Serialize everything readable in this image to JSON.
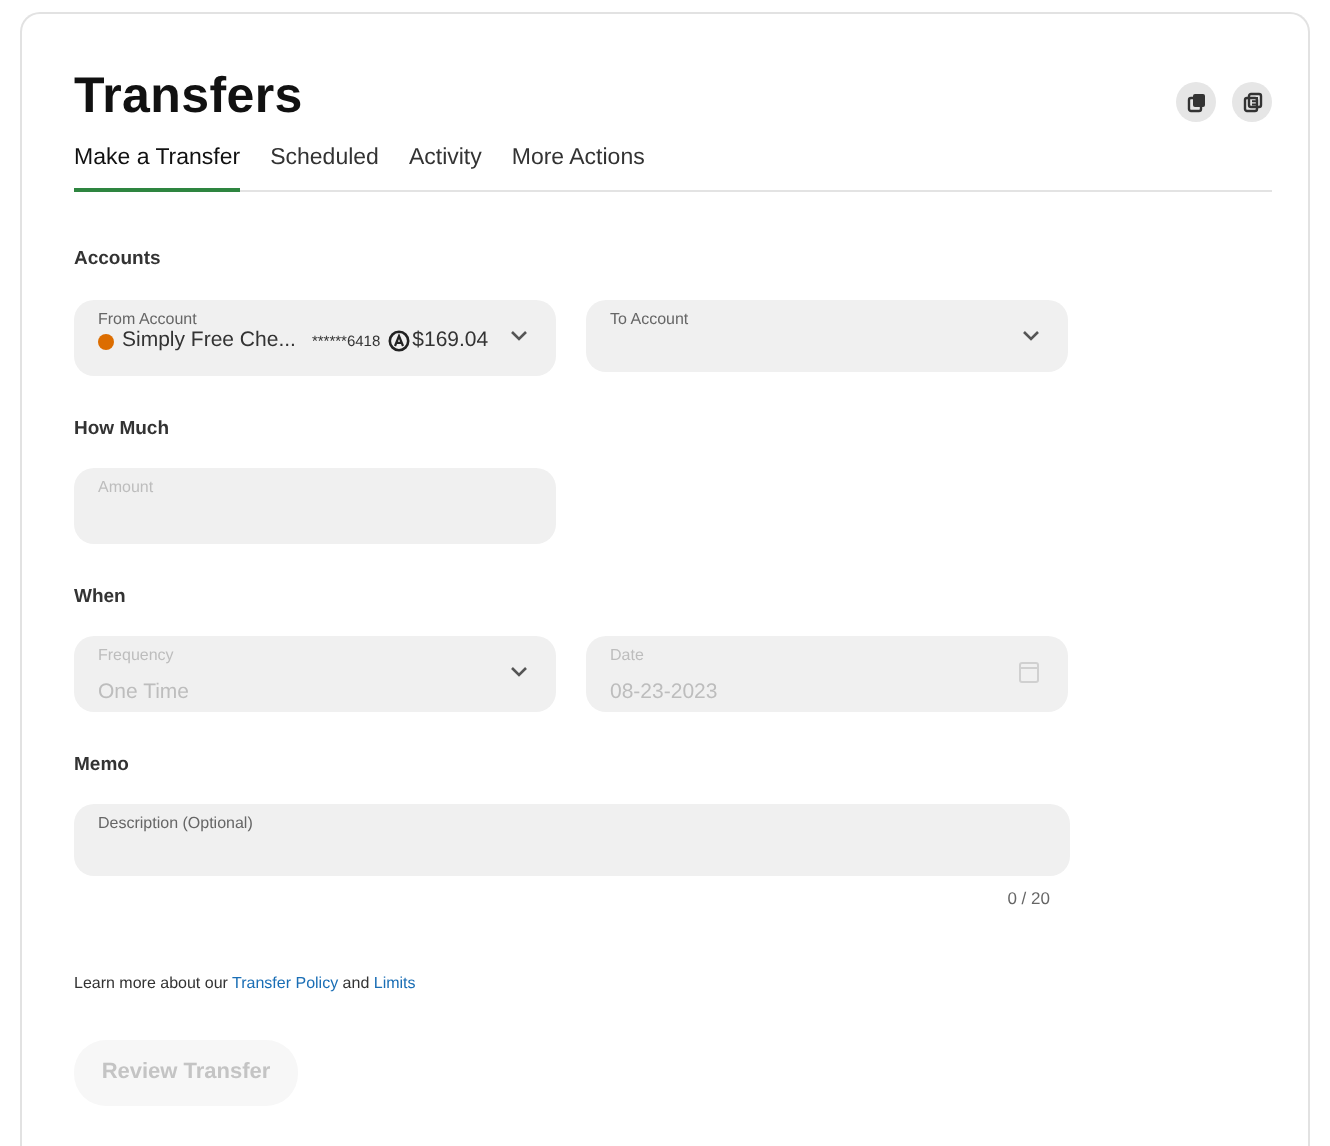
{
  "title": "Transfers",
  "header_buttons": [
    {
      "kind": "copy"
    },
    {
      "kind": "list"
    }
  ],
  "tabs": [
    {
      "label": "Make a Transfer",
      "selected": true
    },
    {
      "label": "Scheduled",
      "selected": false
    },
    {
      "label": "Activity",
      "selected": false
    },
    {
      "label": "More Actions",
      "selected": false
    }
  ],
  "sections": [
    {
      "heading": "Accounts",
      "fields": [
        {
          "kind": "account",
          "label": "From Account",
          "account_name": "Simply Free Che...",
          "account_number": "******6418",
          "balance": "$169.04",
          "color": "#dc6d00",
          "disabled": false
        },
        {
          "kind": "select",
          "label": "To Account",
          "disabled": false
        }
      ]
    },
    {
      "heading": "How Much",
      "fields": [
        {
          "kind": "input",
          "label": "Amount",
          "disabled": true
        }
      ]
    },
    {
      "heading": "When",
      "fields": [
        {
          "kind": "select",
          "label": "Frequency",
          "value": "One Time",
          "disabled": true
        },
        {
          "kind": "date",
          "label": "Date",
          "value": "08-23-2023",
          "disabled": true
        }
      ]
    },
    {
      "heading": "Memo",
      "fields": [
        {
          "kind": "textarea",
          "label": "Description (Optional)",
          "counter": "0 / 20",
          "disabled": false
        }
      ]
    }
  ],
  "note": [
    {
      "kind": "text",
      "text": "Learn more about our "
    },
    {
      "kind": "link",
      "text": "Transfer Policy"
    },
    {
      "kind": "text",
      "text": " and "
    },
    {
      "kind": "link",
      "text": "Limits"
    }
  ],
  "submit": {
    "label": "Review Transfer",
    "disabled": true
  }
}
